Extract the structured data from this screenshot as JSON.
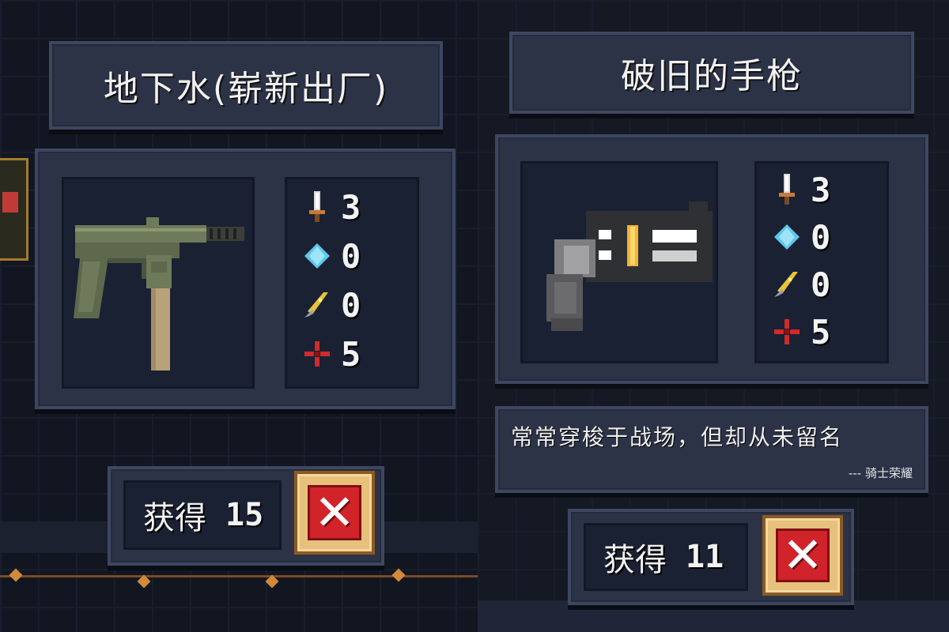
{
  "colors": {
    "panel": "#2c3347",
    "panel_border": "#3e4760",
    "inner": "#1a2132",
    "button_gold": "#e7c07b",
    "button_red": "#d0242a"
  },
  "left_card": {
    "title": "地下水(崭新出厂)",
    "weapon_icon": "smg-icon",
    "stats": [
      {
        "icon": "sword-icon",
        "value": "3"
      },
      {
        "icon": "diamond-gem-icon",
        "value": "0"
      },
      {
        "icon": "pen-dagger-icon",
        "value": "0"
      },
      {
        "icon": "red-cross-icon",
        "value": "5"
      }
    ],
    "obtain_label": "获得",
    "obtain_value": "15",
    "close_label": "✕"
  },
  "right_card": {
    "title": "破旧的手枪",
    "weapon_icon": "pistol-icon",
    "stats": [
      {
        "icon": "sword-icon",
        "value": "3"
      },
      {
        "icon": "diamond-gem-icon",
        "value": "0"
      },
      {
        "icon": "pen-dagger-icon",
        "value": "0"
      },
      {
        "icon": "red-cross-icon",
        "value": "5"
      }
    ],
    "description": "常常穿梭于战场，但却从未留名",
    "signature": "--- 骑士荣耀",
    "obtain_label": "获得",
    "obtain_value": "11",
    "close_label": "✕"
  }
}
